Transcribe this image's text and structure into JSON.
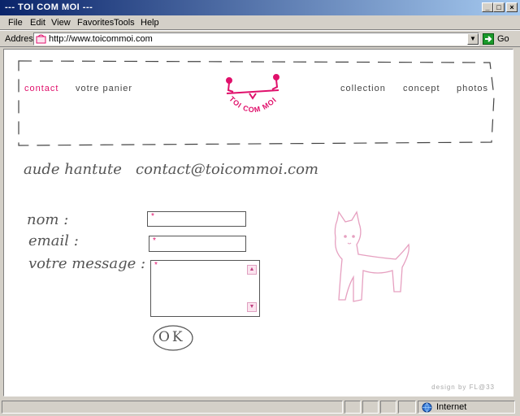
{
  "window": {
    "title": "--- TOI COM MOI ---"
  },
  "menu": [
    "File",
    "Edit",
    "View",
    "Favorites",
    "Tools",
    "Help"
  ],
  "address": {
    "label": "Address",
    "url": "http://www.toicommoi.com",
    "go_label": "Go"
  },
  "nav": {
    "left": [
      "contact",
      "votre panier"
    ],
    "right": [
      "collection",
      "concept",
      "photos"
    ]
  },
  "logo": {
    "text": "TOI COM MOI"
  },
  "contact_line": "aude hantute   contact@toicommoi.com",
  "form": {
    "nom_label": "nom :",
    "email_label": "email :",
    "message_label": "votre message :",
    "required_mark": "*",
    "ok_label": "OK"
  },
  "credit": "design by FL@33",
  "status": {
    "zone": "Internet"
  },
  "colors": {
    "accent": "#e0106b",
    "sketch": "#e6a0c0"
  }
}
